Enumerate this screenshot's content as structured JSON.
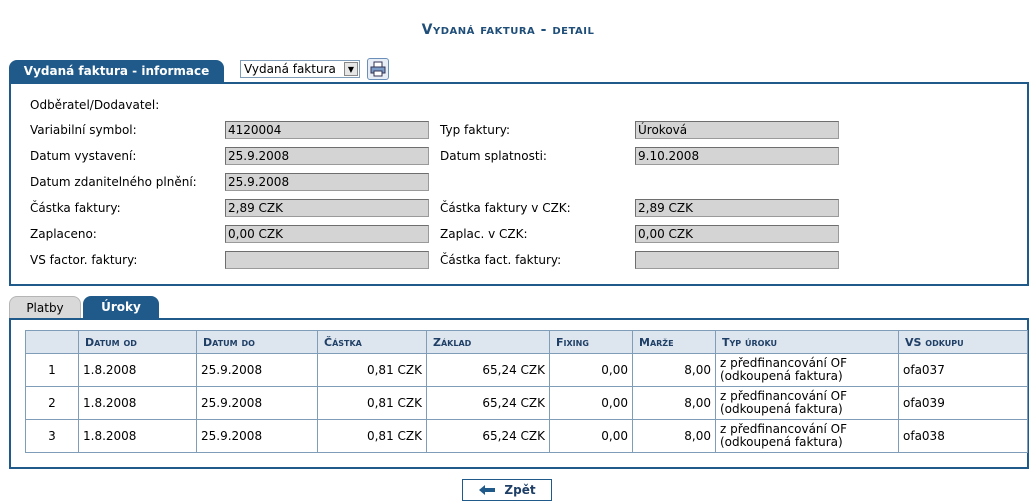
{
  "title": "Vydaná faktura - detail",
  "info_tab": {
    "label": "Vydaná faktura - informace"
  },
  "doc_select": {
    "value": "Vydaná faktura"
  },
  "fields": {
    "odberatel_label": "Odběratel/Dodavatel:",
    "variabilni_symbol": {
      "label": "Variabilní symbol:",
      "value": "4120004"
    },
    "typ_faktury": {
      "label": "Typ faktury:",
      "value": "Úroková"
    },
    "datum_vystaveni": {
      "label": "Datum vystavení:",
      "value": "25.9.2008"
    },
    "datum_splatnosti": {
      "label": "Datum splatnosti:",
      "value": "9.10.2008"
    },
    "datum_zdanitelneho": {
      "label": "Datum zdanitelného plnění:",
      "value": "25.9.2008"
    },
    "castka_faktury": {
      "label": "Částka faktury:",
      "value": "2,89 CZK"
    },
    "castka_faktury_czk": {
      "label": "Částka faktury v CZK:",
      "value": "2,89 CZK"
    },
    "zaplaceno": {
      "label": "Zaplaceno:",
      "value": "0,00 CZK"
    },
    "zaplac_czk": {
      "label": "Zaplac. v CZK:",
      "value": "0,00 CZK"
    },
    "vs_factor": {
      "label": "VS factor. faktury:",
      "value": ""
    },
    "castka_fact": {
      "label": "Částka fact. faktury:",
      "value": ""
    }
  },
  "tabs": {
    "platby": "Platby",
    "uroky": "Úroky"
  },
  "table": {
    "headers": [
      "",
      "Datum od",
      "Datum do",
      "Částka",
      "Základ",
      "Fixing",
      "Marže",
      "Typ úroku",
      "VS odkupu"
    ],
    "rows": [
      [
        "1",
        "1.8.2008",
        "25.9.2008",
        "0,81 CZK",
        "65,24 CZK",
        "0,00",
        "8,00",
        "z předfinancování OF (odkoupená faktura)",
        "ofa037"
      ],
      [
        "2",
        "1.8.2008",
        "25.9.2008",
        "0,81 CZK",
        "65,24 CZK",
        "0,00",
        "8,00",
        "z předfinancování OF (odkoupená faktura)",
        "ofa039"
      ],
      [
        "3",
        "1.8.2008",
        "25.9.2008",
        "0,81 CZK",
        "65,24 CZK",
        "0,00",
        "8,00",
        "z předfinancování OF (odkoupená faktura)",
        "ofa038"
      ]
    ]
  },
  "back_button": {
    "label": "Zpět",
    "icon": "arrow-left-icon"
  },
  "colors": {
    "accent": "#1f5a8a",
    "field_bg": "#d4d4d4",
    "header_bg": "#dde6ef"
  }
}
